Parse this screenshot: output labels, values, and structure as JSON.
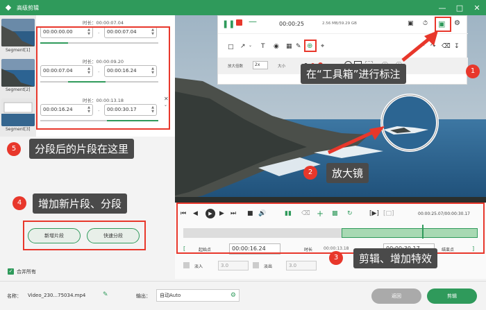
{
  "window": {
    "title": "高级剪辑",
    "controls": [
      "minimize",
      "maximize",
      "close"
    ]
  },
  "segments": {
    "thumbnails": [
      {
        "label": "Segment[1]"
      },
      {
        "label": "Segment[2]"
      },
      {
        "label": "Segment[3]"
      }
    ],
    "blocks": [
      {
        "duration": "时长：00:00:07.04",
        "start": "00:00:00.00",
        "end": "00:00:07.04"
      },
      {
        "duration": "时长：00:00:09.20",
        "start": "00:00:07.04",
        "end": "00:00:16.24"
      },
      {
        "duration": "时长：00:00:13.18",
        "start": "00:00:16.24",
        "end": "00:00:30.17"
      }
    ]
  },
  "recorder": {
    "time": "00:00:25",
    "storage": "2.56 MB/59.29 GB",
    "zoom_label": "放大倍数",
    "zoom_value": "2x",
    "size_label": "大小"
  },
  "annotations": [
    {
      "number": "1",
      "text": "在“工具箱”进行标注"
    },
    {
      "number": "2",
      "text": "放大镜"
    },
    {
      "number": "3",
      "text": "剪辑、增加特效"
    },
    {
      "number": "4",
      "text": "增加新片段、分段"
    },
    {
      "number": "5",
      "text": "分段后的片段在这里"
    }
  ],
  "timeline": {
    "time_display": "00:00:25.07/00:00:30.17",
    "start_point_label": "起始点",
    "start_point_value": "00:00:16.24",
    "duration_label": "时长",
    "duration_value": "00:00:13.18",
    "end_value": "00:00:30.17",
    "end_point_label": "结束点",
    "fade_in_label": "淡入",
    "fade_in_value": "3.0",
    "fade_out_label": "淡出",
    "fade_out_value": "3.0"
  },
  "left_actions": {
    "add_segment": "新增片段",
    "quick_split": "快速分段",
    "merge_all": "合并所有",
    "merge_all_checked": true
  },
  "footer": {
    "name_label": "名称：",
    "name_value": "Video_230...75034.mp4",
    "output_label": "输出：",
    "output_value": "自动Auto",
    "back_button": "返回",
    "clip_button": "剪辑"
  },
  "colors": {
    "accent": "#2f9a5b",
    "annotation_red": "#e8372b",
    "callout_bg": "#4a4a4a"
  }
}
